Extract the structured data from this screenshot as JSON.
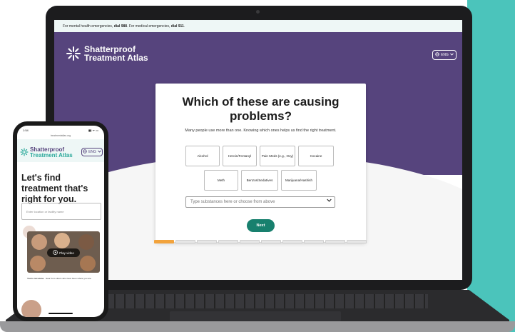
{
  "laptop": {
    "banner": {
      "prefix": "For mental health emergencies, ",
      "dial1": "dial 988",
      "middle": ". For medical emergencies, ",
      "dial2": "dial 911",
      "suffix": "."
    },
    "logo": {
      "line1": "Shatterproof",
      "line2": "Treatment Atlas"
    },
    "lang_label": "ENG",
    "question": {
      "title": "Which of these are causing problems?",
      "subtitle": "Many people use more than one. Knowing which ones helps us find the right treatment."
    },
    "options": [
      "Alcohol",
      "Heroin/Fentanyl",
      "Pain Meds (e.g., Oxy)",
      "Cocaine",
      "Meth",
      "Benzos/Sedatives",
      "Marijuana/Hashish"
    ],
    "select_placeholder": "Type substances here or choose from above",
    "next_label": "Next",
    "progress": {
      "total_steps": 10,
      "current_step": 1
    }
  },
  "phone": {
    "status_time": "1:54",
    "status_icons": "▮▮ ᯤ ▭",
    "url": "treatmentatlas.org",
    "logo": {
      "line1": "Shatterproof",
      "line2": "Treatment Atlas"
    },
    "lang_label": "ENG",
    "headline": "Let's find treatment that's right for you.",
    "input_placeholder": "Enter location or facility name",
    "play_label": "Play video",
    "not_alone_title": "You're not alone.",
    "not_alone_text": "Hear from others who have been where you are."
  },
  "colors": {
    "purple": "#56447d",
    "teal": "#2aa89a",
    "accent_teal": "#4bc4bb",
    "next_green": "#18806e",
    "progress_orange": "#f2a33c"
  },
  "icons": {
    "logo": "sparkle-burst-icon",
    "globe": "globe-icon",
    "chevron": "chevron-down-icon",
    "play": "play-circle-icon"
  }
}
